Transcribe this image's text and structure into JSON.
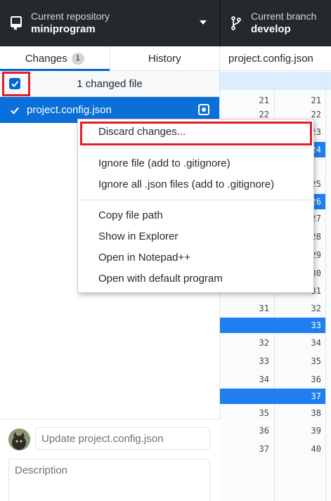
{
  "toolbar": {
    "repo_caption": "Current repository",
    "repo_name": "miniprogram",
    "branch_caption": "Current branch",
    "branch_name": "develop"
  },
  "tabs": {
    "changes_label": "Changes",
    "changes_count": "1",
    "history_label": "History"
  },
  "changes": {
    "header": "1 changed file",
    "files": [
      "project.config.json"
    ]
  },
  "commit": {
    "summary_placeholder": "Update project.config.json",
    "description_placeholder": "Description"
  },
  "diff": {
    "file_title": "project.config.json",
    "gutter": [
      [
        "21",
        "21"
      ],
      [
        "22",
        "22"
      ],
      [
        "",
        "23"
      ],
      [
        "",
        "24"
      ],
      [
        "",
        "25"
      ],
      [
        "",
        "26"
      ],
      [
        "",
        "27"
      ],
      [
        "",
        "28"
      ],
      [
        "",
        "29"
      ],
      [
        "",
        "30"
      ],
      [
        "",
        "31"
      ],
      [
        "31",
        "32"
      ],
      [
        "",
        "33"
      ],
      [
        "32",
        "34"
      ],
      [
        "33",
        "35"
      ],
      [
        "34",
        "36"
      ],
      [
        "",
        "37"
      ],
      [
        "35",
        "38"
      ],
      [
        "36",
        "39"
      ],
      [
        "37",
        "40"
      ]
    ]
  },
  "context_menu": {
    "items": [
      "Discard changes...",
      "Ignore file (add to .gitignore)",
      "Ignore all .json files (add to .gitignore)",
      "Copy file path",
      "Show in Explorer",
      "Open in Notepad++",
      "Open with default program"
    ]
  },
  "colors": {
    "toolbar_bg": "#24292e",
    "accent_blue": "#0366d6",
    "selected_row": "#0a6fd9",
    "highlight_red": "#e0202a"
  }
}
